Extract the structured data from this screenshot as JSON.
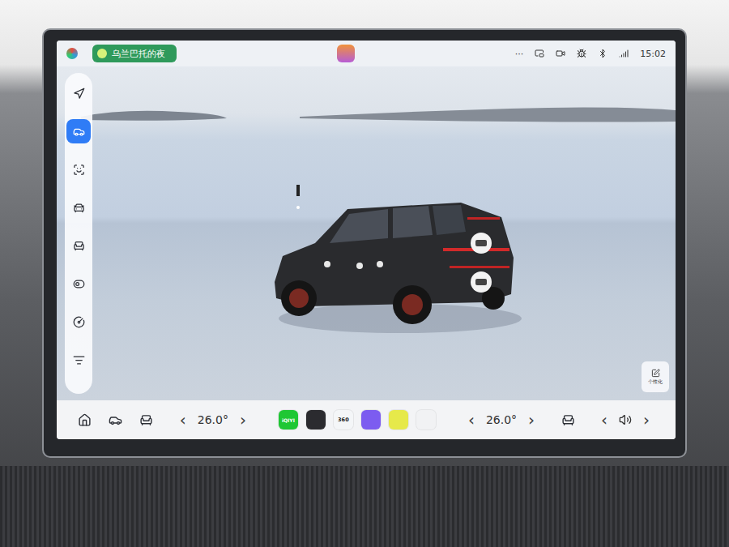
{
  "status_bar": {
    "media": {
      "title": "乌兰巴托的夜"
    },
    "more": "···",
    "time": "15:02"
  },
  "sidebar": {
    "items": [
      {
        "selected": false
      },
      {
        "selected": true
      },
      {
        "selected": false
      },
      {
        "selected": false
      },
      {
        "selected": false
      },
      {
        "selected": false
      },
      {
        "selected": false
      },
      {
        "selected": false
      }
    ]
  },
  "personalize_button": {
    "label": "个性化"
  },
  "dock": {
    "left_climate": {
      "decrease": "‹",
      "temperature": "26.0°",
      "increase": "›"
    },
    "apps": [
      {
        "label": "iQIYI",
        "color": "#1fc734"
      },
      {
        "color": "#2b2b2f"
      },
      {
        "label": "360",
        "color": "#f4f6f8"
      },
      {
        "color": "#7c5cf0"
      },
      {
        "color": "#e6e94a"
      },
      {
        "color": "#f1f2f4"
      }
    ],
    "right_climate": {
      "decrease": "‹",
      "temperature": "26.0°",
      "increase": "›"
    },
    "volume": {
      "decrease": "‹",
      "increase": "›"
    }
  }
}
